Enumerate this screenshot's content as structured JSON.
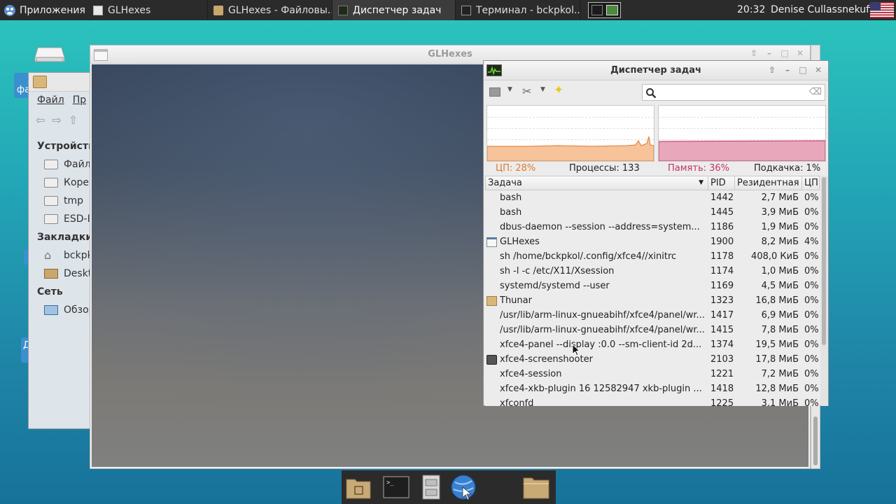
{
  "top_panel": {
    "apps_label": "Приложения",
    "tasks": [
      {
        "label": "GLHexes",
        "active": false
      },
      {
        "label": "GLHexes - Файловы...",
        "active": false
      },
      {
        "label": "Диспетчер задач",
        "active": true
      },
      {
        "label": "Терминал - bckpkol...",
        "active": false
      }
    ],
    "clock": "20:32",
    "user": "Denise Cullassnekuff"
  },
  "thunar": {
    "menu": [
      "Файл",
      "Пр"
    ],
    "sections": [
      {
        "header": "Устройств",
        "items": [
          "Файл",
          "Корен",
          "tmp",
          "ESD-I"
        ]
      },
      {
        "header": "Закладки",
        "items": [
          "bckpk",
          "Deskt"
        ]
      },
      {
        "header": "Сеть",
        "items": [
          "Обзор"
        ]
      }
    ]
  },
  "desktop_labels": [
    "фа",
    "Д"
  ],
  "glhexes": {
    "title": "GLHexes"
  },
  "taskmgr": {
    "title": "Диспетчер задач",
    "search_placeholder": "",
    "stats": {
      "cpu": "ЦП: 28%",
      "processes": "Процессы: 133",
      "memory": "Память: 36%",
      "swap": "Подкачка: 1%"
    },
    "columns": {
      "task": "Задача",
      "pid": "PID",
      "rss": "Резидентная",
      "cpu": "ЦП"
    },
    "processes": [
      {
        "name": "bash",
        "pid": "1442",
        "rss": "2,7 МиБ",
        "cpu": "0%",
        "icon": "none"
      },
      {
        "name": "bash",
        "pid": "1445",
        "rss": "3,9 МиБ",
        "cpu": "0%",
        "icon": "none"
      },
      {
        "name": "dbus-daemon --session --address=system...",
        "pid": "1186",
        "rss": "1,9 МиБ",
        "cpu": "0%",
        "icon": "none"
      },
      {
        "name": "GLHexes",
        "pid": "1900",
        "rss": "8,2 МиБ",
        "cpu": "4%",
        "icon": "window-icon"
      },
      {
        "name": "sh /home/bckpkol/.config/xfce4//xinitrc",
        "pid": "1178",
        "rss": "408,0 КиБ",
        "cpu": "0%",
        "icon": "none"
      },
      {
        "name": "sh -l -c /etc/X11/Xsession",
        "pid": "1174",
        "rss": "1,0 МиБ",
        "cpu": "0%",
        "icon": "none"
      },
      {
        "name": "systemd/systemd --user",
        "pid": "1169",
        "rss": "4,5 МиБ",
        "cpu": "0%",
        "icon": "none"
      },
      {
        "name": "Thunar",
        "pid": "1323",
        "rss": "16,8 МиБ",
        "cpu": "0%",
        "icon": "folder-icon"
      },
      {
        "name": "/usr/lib/arm-linux-gnueabihf/xfce4/panel/wr...",
        "pid": "1417",
        "rss": "6,9 МиБ",
        "cpu": "0%",
        "icon": "none"
      },
      {
        "name": "/usr/lib/arm-linux-gnueabihf/xfce4/panel/wr...",
        "pid": "1415",
        "rss": "7,8 МиБ",
        "cpu": "0%",
        "icon": "none"
      },
      {
        "name": "xfce4-panel --display :0.0 --sm-client-id 2d...",
        "pid": "1374",
        "rss": "19,5 МиБ",
        "cpu": "0%",
        "icon": "none"
      },
      {
        "name": "xfce4-screenshooter",
        "pid": "2103",
        "rss": "17,8 МиБ",
        "cpu": "0%",
        "icon": "camera-icon"
      },
      {
        "name": "xfce4-session",
        "pid": "1221",
        "rss": "7,2 МиБ",
        "cpu": "0%",
        "icon": "none"
      },
      {
        "name": "xfce4-xkb-plugin  16 12582947 xkb-plugin ...",
        "pid": "1418",
        "rss": "12,8 МиБ",
        "cpu": "0%",
        "icon": "none"
      },
      {
        "name": "xfconfd",
        "pid": "1225",
        "rss": "3,1 МиБ",
        "cpu": "0%",
        "icon": "none"
      }
    ],
    "colors": {
      "cpu": "#e07a2e",
      "memory": "#c2335f"
    }
  },
  "dock": {
    "items": [
      "home-folder-icon",
      "terminal-icon",
      "file-cabinet-icon",
      "web-browser-icon",
      "folder-icon"
    ]
  }
}
